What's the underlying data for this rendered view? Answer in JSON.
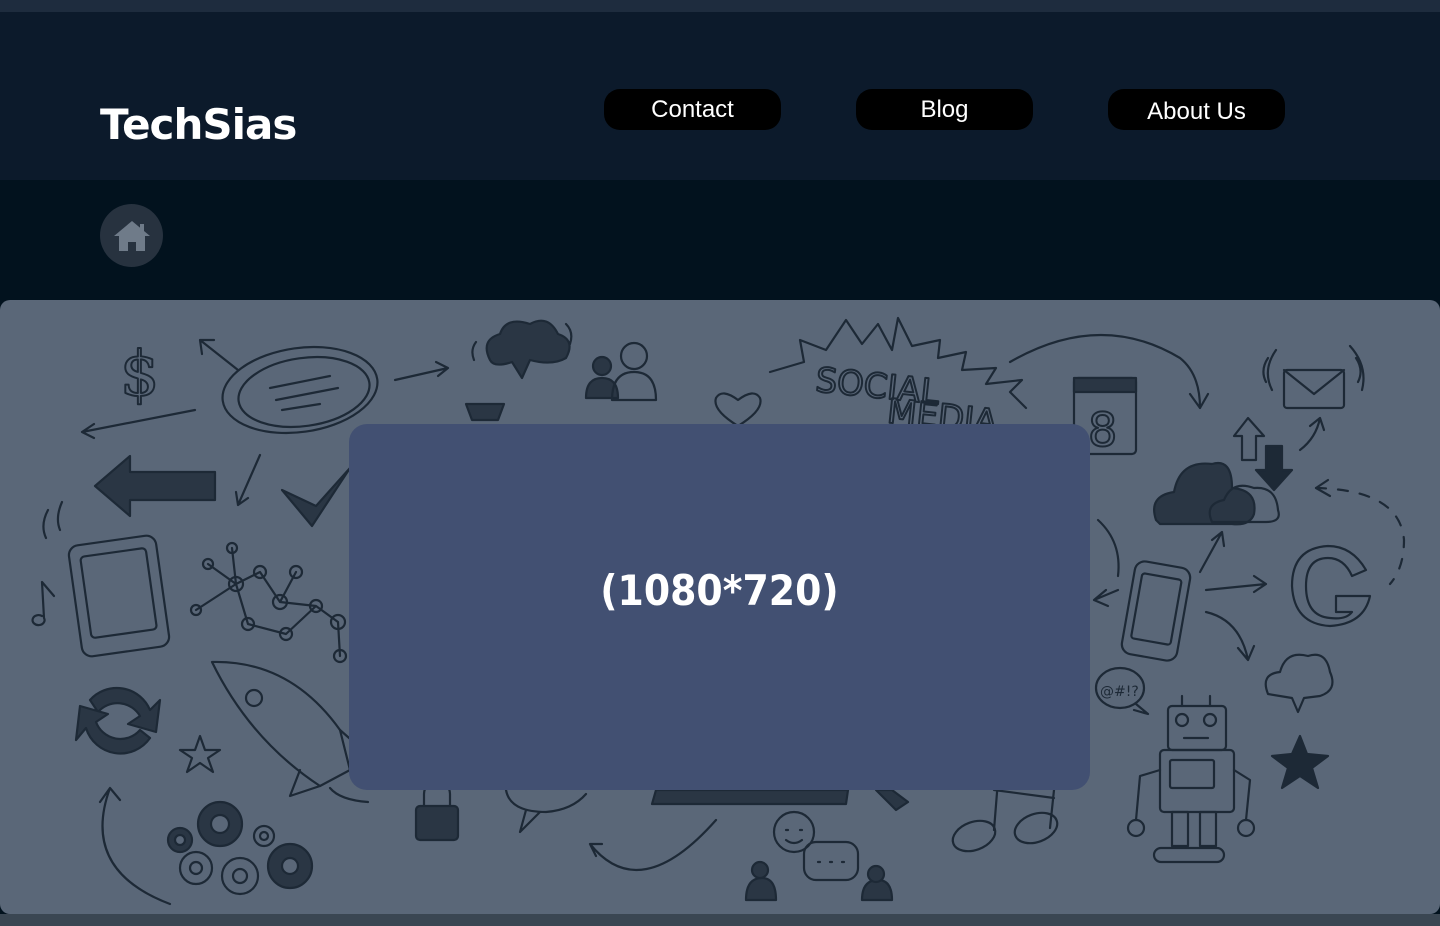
{
  "header": {
    "logo": "TechSias",
    "nav": [
      {
        "label": "Contact"
      },
      {
        "label": "Blog"
      },
      {
        "label": "About Us"
      }
    ]
  },
  "toolbar": {
    "home_icon": "home-icon"
  },
  "hero": {
    "doodle_text": "SOCIAL MEDIA",
    "calendar_number": "8",
    "placeholder_label": "(1080*720)"
  },
  "colors": {
    "page_bg": "#02121e",
    "header_bg": "#0c1a2b",
    "hero_bg": "#5a6778",
    "placeholder_bg": "#425072",
    "nav_button_bg": "#000000"
  }
}
